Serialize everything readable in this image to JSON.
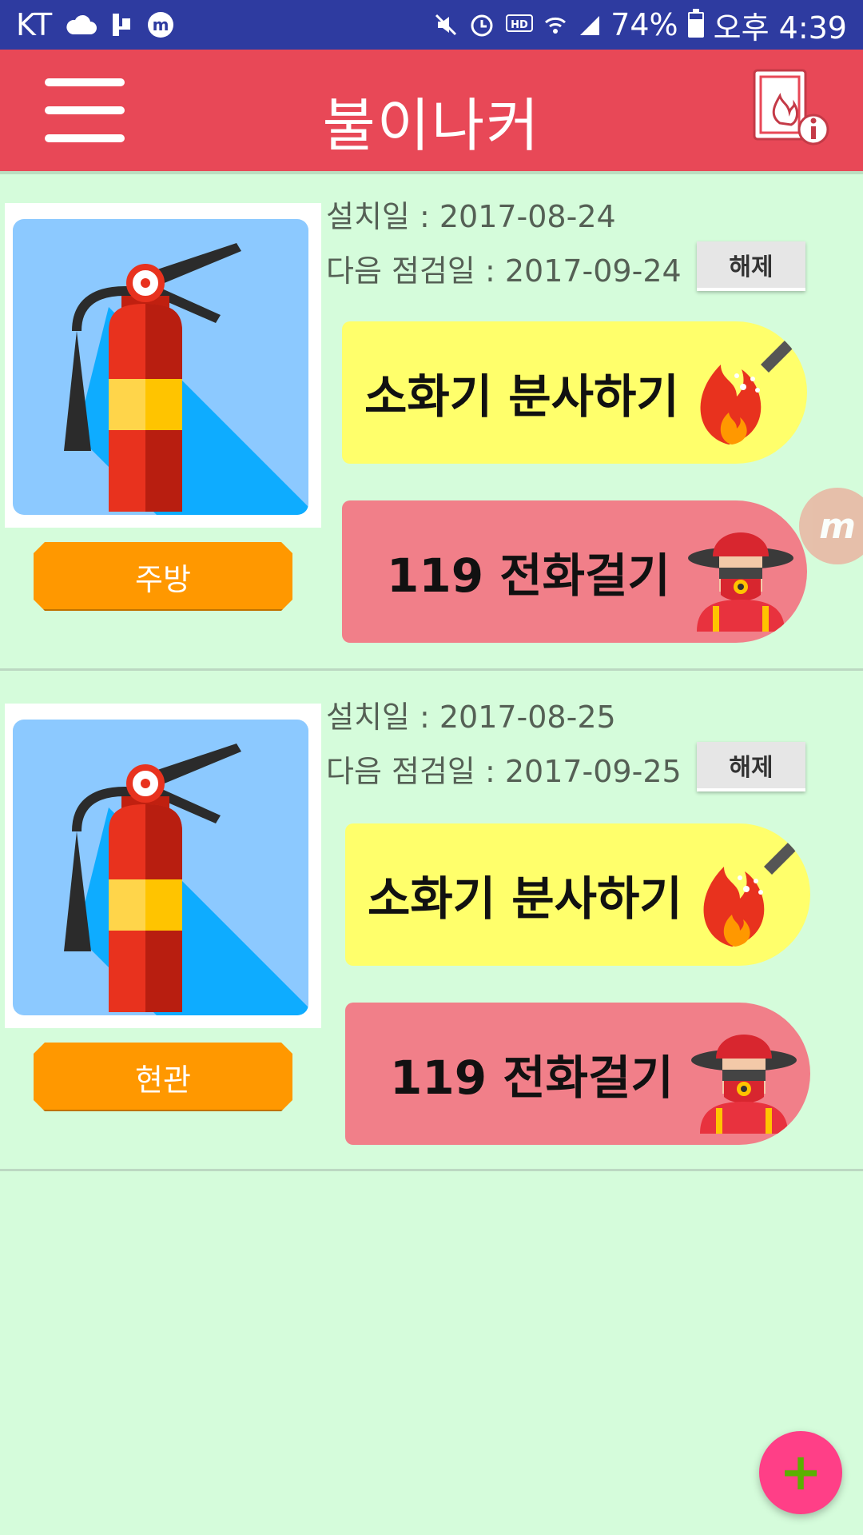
{
  "status_bar": {
    "carrier": "KT",
    "battery": "74%",
    "time": "오후 4:39",
    "icons": [
      "cloud-icon",
      "usb-icon",
      "messenger-icon",
      "mute-icon",
      "alarm-icon",
      "hd-icon",
      "wifi-icon",
      "signal-icon",
      "battery-icon"
    ],
    "battery_level": 0.74
  },
  "app_bar": {
    "title": "불이나커",
    "menu_icon": "hamburger-icon",
    "info_icon": "fire-info-icon"
  },
  "cards": [
    {
      "install_date": "설치일 : 2017-08-24",
      "next_inspection": "다음 점검일 : 2017-09-24",
      "release_label": "해제",
      "location": "주방",
      "spray_label": "소화기 분사하기",
      "call_label": "119 전화걸기"
    },
    {
      "install_date": "설치일 : 2017-08-25",
      "next_inspection": "다음 점검일 : 2017-09-25",
      "release_label": "해제",
      "location": "현관",
      "spray_label": "소화기 분사하기",
      "call_label": "119 전화걸기"
    }
  ],
  "fab": {
    "label": "+"
  },
  "colors": {
    "status_bar": "#2e3ba0",
    "app_bar": "#e84857",
    "background": "#d5fcdb",
    "badge": "#ff9800",
    "spray_button": "#ffff6b",
    "call_button": "#f17f89",
    "fab": "#ff3f87"
  }
}
